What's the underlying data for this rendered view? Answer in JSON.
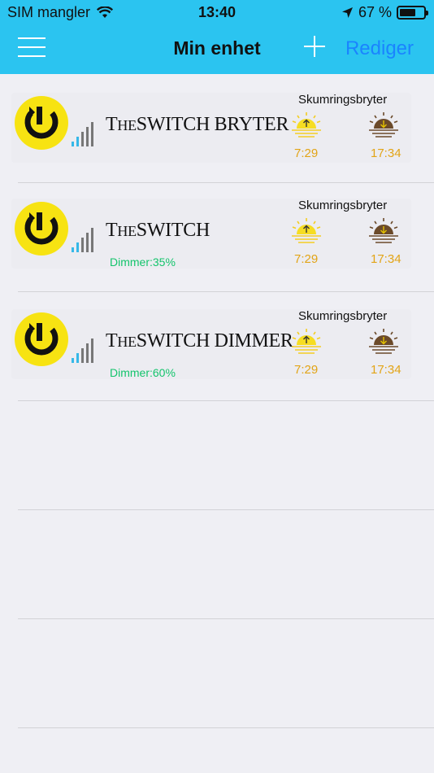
{
  "status": {
    "carrier": "SIM mangler",
    "time": "13:40",
    "battery": "67 %",
    "battery_level": 0.67
  },
  "nav": {
    "title": "Min enhet",
    "edit_label": "Rediger"
  },
  "devices": [
    {
      "name_prefix": "T",
      "name_small": "HE",
      "name_rest": "SWITCH BRYTER",
      "dimmer": "",
      "mode": "Skumringsbryter",
      "sunrise": "7:29",
      "sunset": "17:34"
    },
    {
      "name_prefix": "T",
      "name_small": "HE",
      "name_rest": "SWITCH",
      "dimmer": "Dimmer:35%",
      "mode": "Skumringsbryter",
      "sunrise": "7:29",
      "sunset": "17:34"
    },
    {
      "name_prefix": "T",
      "name_small": "HE",
      "name_rest": "SWITCH DIMMER",
      "dimmer": "Dimmer:60%",
      "mode": "Skumringsbryter",
      "sunrise": "7:29",
      "sunset": "17:34"
    }
  ],
  "colors": {
    "header": "#2bc4f0",
    "accent": "#1a84ff",
    "time": "#e2a416",
    "dimmer": "#14c46c",
    "logo": "#f7e312"
  },
  "icons": {
    "menu": "hamburger-icon",
    "add": "plus-icon",
    "wifi": "wifi-icon",
    "location": "location-arrow-icon",
    "battery": "battery-icon",
    "power": "power-icon",
    "signal": "signal-bars-icon",
    "sunrise": "sunrise-icon",
    "sunset": "sunset-icon"
  }
}
